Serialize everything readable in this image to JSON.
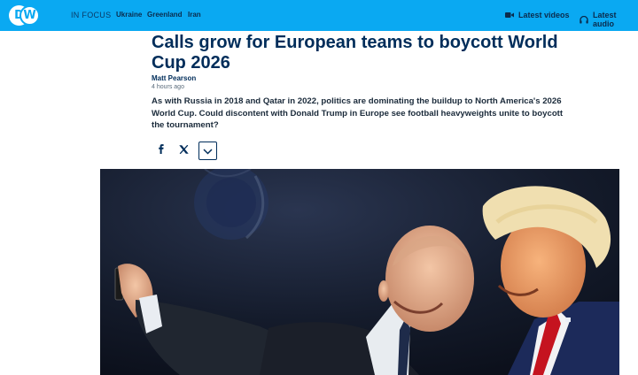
{
  "header": {
    "logo_text": "DW",
    "in_focus_label": "IN FOCUS",
    "topics": [
      "Ukraine",
      "Greenland",
      "Iran"
    ],
    "latest_videos": "Latest videos",
    "latest_audio": "Latest audio",
    "bar_color": "#0aa9f2"
  },
  "article": {
    "headline": "Calls grow for European teams to boycott World Cup 2026",
    "author": "Matt Pearson",
    "published_ago": "4 hours ago",
    "teaser": "As with Russia in 2018 and Qatar in 2022, politics are dominating the buildup to North America's 2026 World Cup. Could discontent with Donald Trump in Europe see football heavyweights unite to boycott the tournament?",
    "title_color": "#002d5a"
  },
  "share": {
    "icons": [
      "facebook-icon",
      "x-icon",
      "chevron-down-icon"
    ]
  },
  "hero_image": {
    "icon": "photo"
  }
}
